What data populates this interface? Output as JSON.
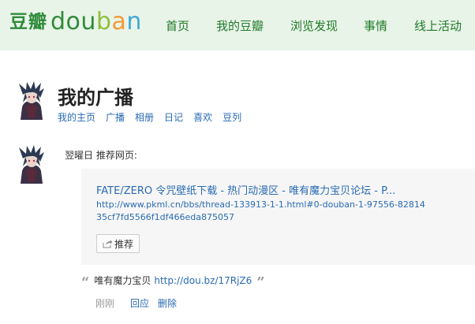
{
  "logo": {
    "cn": "豆瓣",
    "en_parts": [
      "d",
      "o",
      "u",
      "b",
      "a",
      "n"
    ]
  },
  "nav": {
    "items": [
      {
        "label": "首页"
      },
      {
        "label": "我的豆瓣"
      },
      {
        "label": "浏览发现"
      },
      {
        "label": "事情"
      },
      {
        "label": "线上活动"
      }
    ]
  },
  "profile": {
    "title": "我的广播",
    "subnav": [
      "我的主页",
      "广播",
      "相册",
      "日记",
      "喜欢",
      "豆列"
    ]
  },
  "post": {
    "author": "翌曜日",
    "action": "推荐网页:",
    "card": {
      "title": "FATE/ZERO 令咒壁纸下载 - 热门动漫区 - 唯有魔力宝贝论坛 - P...",
      "url": "http://www.pkml.cn/bbs/thread-133913-1-1.html#0-douban-1-97556-8281435cf7fd5566f1df466eda875057",
      "recommend_label": "推荐"
    },
    "quote": {
      "open": "“",
      "text": "唯有魔力宝贝",
      "link": "http://dou.bz/17RjZ6",
      "close": "”"
    },
    "time": "刚刚",
    "actions": [
      "回应",
      "删除"
    ]
  },
  "colors": {
    "nav_bg": "#e9f4e9",
    "brand_green": "#2f8b3a",
    "link_blue": "#2a6bb2",
    "card_bg": "#f6f6f6"
  }
}
